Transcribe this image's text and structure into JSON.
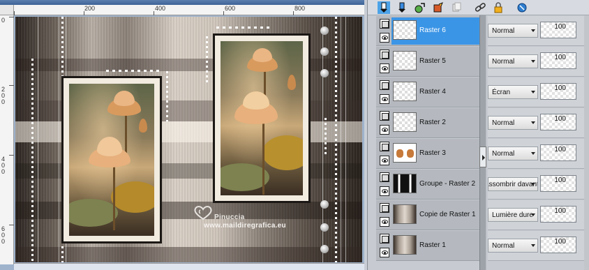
{
  "rulers": {
    "horizontal": [
      "200",
      "400",
      "600",
      "800"
    ],
    "vertical": [
      "0",
      "2 0 0",
      "4 0 0",
      "6 0 0"
    ]
  },
  "watermark": {
    "name": "Pinuccia",
    "url": "www.maildiregrafica.eu"
  },
  "toolbar": {
    "icons": [
      "new-raster-layer-icon",
      "new-vector-layer-icon",
      "new-adjustment-layer-icon",
      "new-mask-icon",
      "duplicate-layer-icon",
      "link-icon",
      "lock-icon",
      "delete-layer-icon"
    ]
  },
  "layers": [
    {
      "name": "Raster 6",
      "blend": "Normal",
      "opacity": "100",
      "selected": true
    },
    {
      "name": "Raster 5",
      "blend": "Normal",
      "opacity": "100",
      "selected": false
    },
    {
      "name": "Raster 4",
      "blend": "Écran",
      "opacity": "100",
      "selected": false
    },
    {
      "name": "Raster 2",
      "blend": "Normal",
      "opacity": "100",
      "selected": false
    },
    {
      "name": "Raster 3",
      "blend": "Normal",
      "opacity": "100",
      "selected": false
    },
    {
      "name": "Groupe - Raster 2",
      "blend": "Assombrir davantage",
      "opacity": "100",
      "selected": false
    },
    {
      "name": "Copie de Raster 1",
      "blend": "Lumière dure",
      "opacity": "100",
      "selected": false
    },
    {
      "name": "Raster 1",
      "blend": "Normal",
      "opacity": "100",
      "selected": false
    }
  ],
  "colors": {
    "selection": "#3b95e6",
    "panel": "#c7cbd1"
  }
}
